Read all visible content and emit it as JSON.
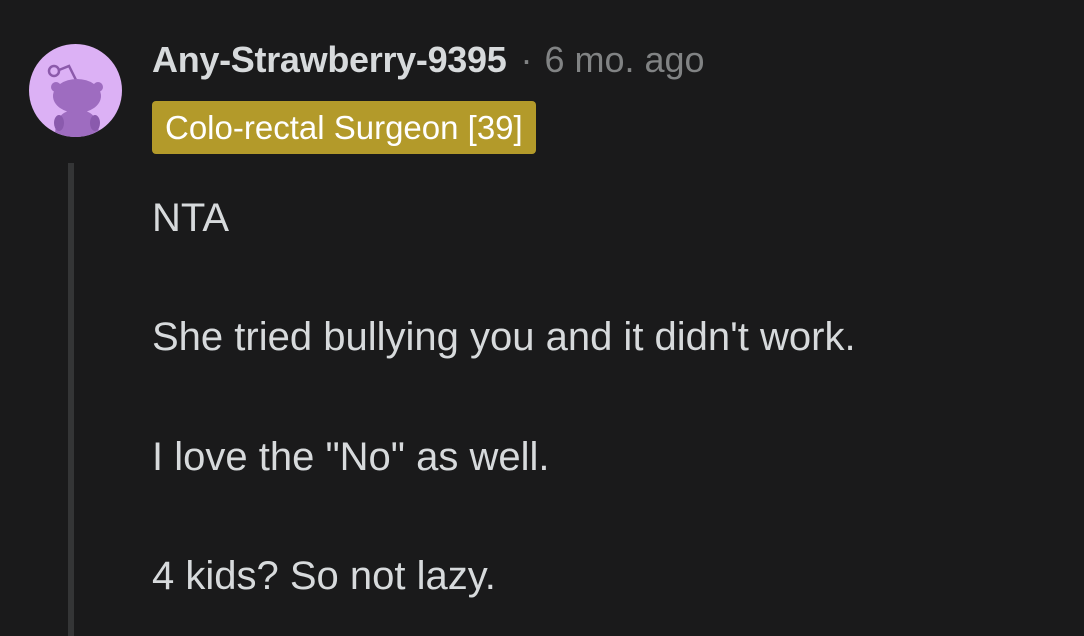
{
  "comment": {
    "username": "Any-Strawberry-9395",
    "separator": "·",
    "timestamp": "6 mo. ago",
    "flair": "Colo-rectal Surgeon [39]",
    "paragraphs": [
      "NTA",
      "She tried bullying you and it didn't work.",
      "I love the \"No\" as well.",
      "4 kids? So not lazy."
    ]
  },
  "colors": {
    "background": "#1a1a1b",
    "text": "#d7dadc",
    "muted": "#818384",
    "flair_background": "#b39a2a",
    "avatar_background": "#dcb1f5",
    "thread_line": "#343536"
  },
  "icons": {
    "avatar": "snoo-avatar-icon"
  }
}
